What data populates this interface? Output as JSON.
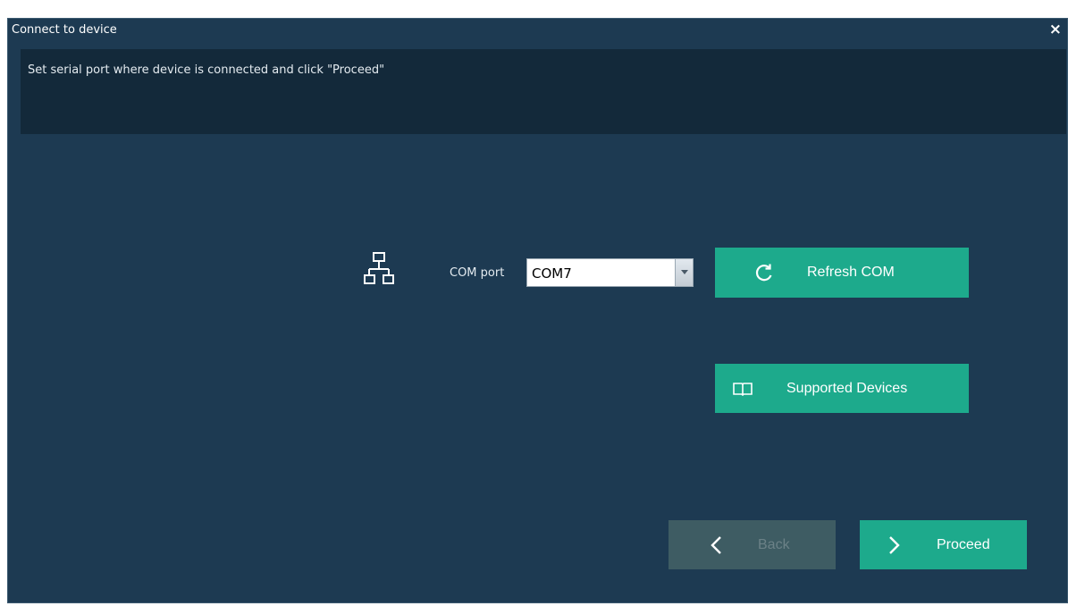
{
  "window": {
    "title": "Connect to device",
    "close_label": "×"
  },
  "info": {
    "message": "Set serial port where device is connected and click \"Proceed\""
  },
  "com": {
    "label": "COM port",
    "selected": "COM7"
  },
  "buttons": {
    "refresh_label": "Refresh COM",
    "supported_label": "Supported Devices",
    "back_label": "Back",
    "proceed_label": "Proceed"
  },
  "icons": {
    "network": "network-icon",
    "refresh": "refresh-icon",
    "book": "book-icon",
    "back": "chevron-left-icon",
    "proceed": "chevron-right-icon"
  },
  "colors": {
    "window_bg": "#1d3a52",
    "info_bg": "#13293a",
    "accent": "#1daa8c",
    "disabled": "#3e5c63"
  }
}
